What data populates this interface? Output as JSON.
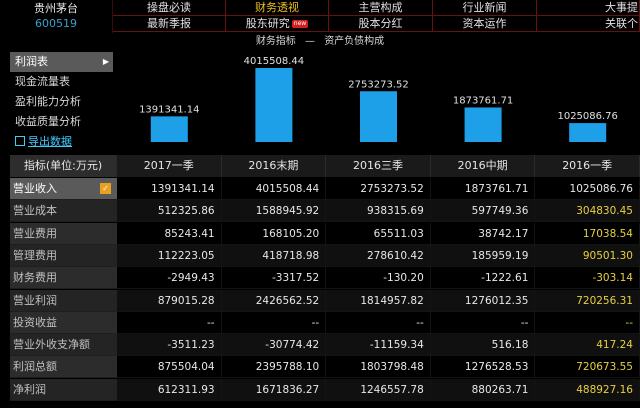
{
  "stock": {
    "name": "贵州茅台",
    "code": "600519"
  },
  "menu": {
    "row1": [
      "操盘必读",
      "财务透视",
      "主营构成",
      "行业新闻",
      "大事提"
    ],
    "row2": [
      "最新季报",
      "股东研究",
      "股本分红",
      "资本运作",
      "关联个"
    ],
    "active": "财务透视",
    "new_badge": "new"
  },
  "chart_header": {
    "left": "财务指标",
    "separator": "—",
    "right": "资产负债构成"
  },
  "sidebar": {
    "items": [
      "利润表",
      "现金流量表",
      "盈利能力分析",
      "收益质量分析"
    ],
    "export_label": "导出数据"
  },
  "chart_data": {
    "type": "bar",
    "categories": [
      "2017一季",
      "2016末期",
      "2016三季",
      "2016中期",
      "2016一季"
    ],
    "values": [
      1391341.14,
      4015508.44,
      2753273.52,
      1873761.71,
      1025086.76
    ],
    "value_labels": [
      "1391341.14",
      "4015508.44",
      "2753273.52",
      "1873761.71",
      "1025086.76"
    ],
    "ylim": [
      0,
      4015508.44
    ],
    "bar_color": "#1ea0e8"
  },
  "table": {
    "header_label": "指标(单位:万元)",
    "columns": [
      "2017一季",
      "2016末期",
      "2016三季",
      "2016中期",
      "2016一季"
    ],
    "rows": [
      {
        "label": "营业收入",
        "values": [
          "1391341.14",
          "4015508.44",
          "2753273.52",
          "1873761.71",
          "1025086.76"
        ]
      },
      {
        "label": "营业成本",
        "values": [
          "512325.86",
          "1588945.92",
          "938315.69",
          "597749.36",
          "304830.45"
        ]
      },
      {
        "label": "营业费用",
        "values": [
          "85243.41",
          "168105.20",
          "65511.03",
          "38742.17",
          "17038.54"
        ]
      },
      {
        "label": "管理费用",
        "values": [
          "112223.05",
          "418718.98",
          "278610.42",
          "185959.19",
          "90501.30"
        ]
      },
      {
        "label": "财务费用",
        "values": [
          "-2949.43",
          "-3317.52",
          "-130.20",
          "-1222.61",
          "-303.14"
        ]
      },
      {
        "label": "营业利润",
        "values": [
          "879015.28",
          "2426562.52",
          "1814957.82",
          "1276012.35",
          "720256.31"
        ]
      },
      {
        "label": "投资收益",
        "values": [
          "--",
          "--",
          "--",
          "--",
          "--"
        ]
      },
      {
        "label": "营业外收支净额",
        "values": [
          "-3511.23",
          "-30774.42",
          "-11159.34",
          "516.18",
          "417.24"
        ]
      },
      {
        "label": "利润总额",
        "values": [
          "875504.04",
          "2395788.10",
          "1803798.48",
          "1276528.53",
          "720673.55"
        ]
      },
      {
        "label": "净利润",
        "values": [
          "612311.93",
          "1671836.27",
          "1246557.78",
          "880263.71",
          "488927.16"
        ]
      }
    ]
  },
  "colors": {
    "accent": "#e8c020",
    "bar": "#1ea0e8",
    "link": "#40c8ff"
  }
}
